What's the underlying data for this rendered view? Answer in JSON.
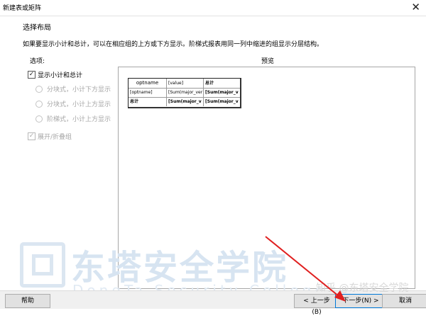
{
  "window": {
    "title": "新建表或矩阵",
    "close_glyph": "✕"
  },
  "page": {
    "section_title": "选择布局",
    "description": "如果要显示小计和总计，可以在相应组的上方或下方显示。阶梯式报表用同一列中缩进的组显示分层结构。"
  },
  "options": {
    "label": "选项:",
    "show_subtotals": {
      "label": "显示小计和总计",
      "checked": true
    },
    "layouts": [
      {
        "label": "分块式，小计下方显示",
        "selected": false,
        "enabled": false
      },
      {
        "label": "分块式，小计上方显示",
        "selected": false,
        "enabled": false
      },
      {
        "label": "阶梯式，小计上方显示",
        "selected": false,
        "enabled": false
      }
    ],
    "expand_collapse": {
      "label": "展开/折叠组",
      "checked": true,
      "enabled": false
    }
  },
  "preview": {
    "label": "预览",
    "rows": [
      [
        "optname",
        "[value]",
        "总计"
      ],
      [
        "[optname]",
        "[Sum(major_ver",
        "[Sum(major_v"
      ],
      [
        "总计",
        "[Sum(major_v",
        "[Sum(major_v"
      ]
    ]
  },
  "watermark": {
    "chinese": "东塔安全学院",
    "english": "DongTa Security College",
    "zhihu": "知乎 @东塔安全学院"
  },
  "footer": {
    "help": "帮助",
    "back": "< 上一步(B)",
    "next": "下一步(N) >",
    "cancel": "取消"
  },
  "colors": {
    "accent": "#0078d7",
    "arrow": "#e02020",
    "watermark": "#d7e4f1"
  }
}
